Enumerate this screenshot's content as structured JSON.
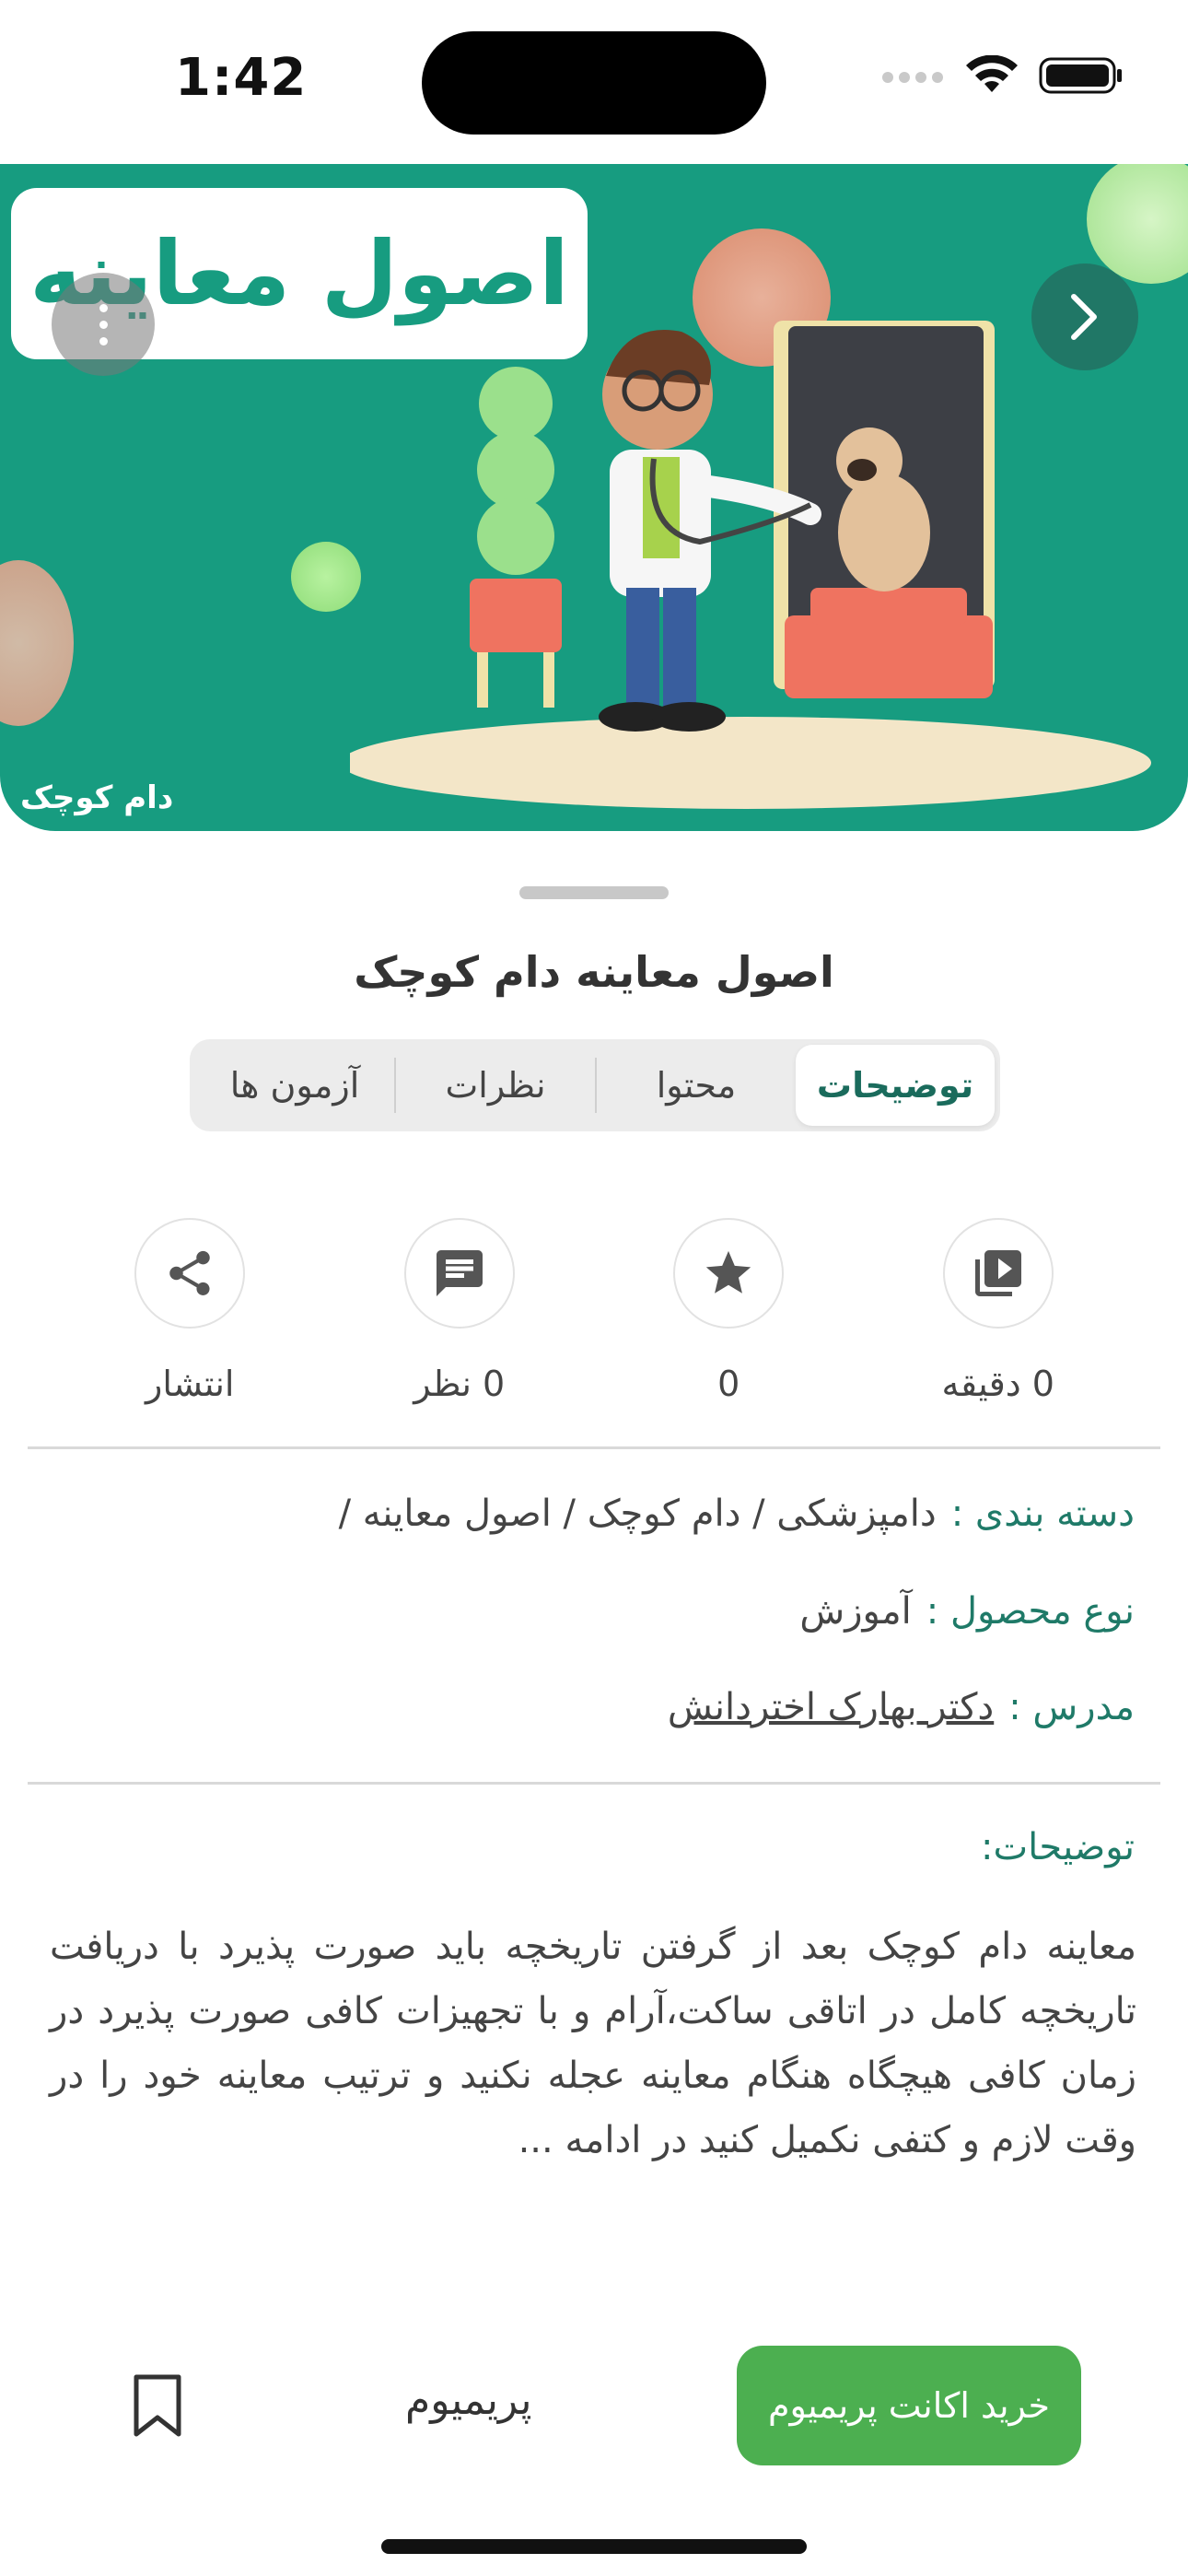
{
  "status_bar": {
    "time": "1:42"
  },
  "hero": {
    "title": "اصول معاینه",
    "brand": "دام کوچک",
    "colors": {
      "background": "#179c80",
      "title_card": "#ffffff"
    }
  },
  "course": {
    "title": "اصول معاینه دام کوچک"
  },
  "tabs": [
    {
      "label": "توضیحات",
      "active": true
    },
    {
      "label": "محتوا",
      "active": false
    },
    {
      "label": "نظرات",
      "active": false
    },
    {
      "label": "آزمون ها",
      "active": false
    }
  ],
  "stats": [
    {
      "icon": "video-library-icon",
      "label": "0 دقیقه"
    },
    {
      "icon": "star-icon",
      "label": "0"
    },
    {
      "icon": "comment-icon",
      "label": "0 نظر"
    },
    {
      "icon": "share-icon",
      "label": "انتشار"
    }
  ],
  "info": {
    "category_key": "دسته بندی :",
    "category_value": "دامپزشکی / دام کوچک / اصول معاینه /",
    "type_key": "نوع محصول :",
    "type_value": "آموزش",
    "teacher_key": "مدرس :",
    "teacher_value": "دکتر بهارک اختردانش"
  },
  "description": {
    "heading": "توضیحات:",
    "body": "معاینه دام کوچک  بعد از گرفتن تاریخچه باید صورت پذیرد با دریافت تاریخچه کامل در اتاقی ساکت،آرام و با تجهیزات کافی صورت پذیرد در زمان کافی هیچگاه هنگام معاینه عجله نکنید و ترتیب معاینه خود را در وقت لازم و کتفی نکمیل کنید در ادامه ..."
  },
  "bottom_bar": {
    "buy_label": "خرید اکانت پریمیوم",
    "premium_label": "پریمیوم",
    "accent": "#4caf50"
  }
}
